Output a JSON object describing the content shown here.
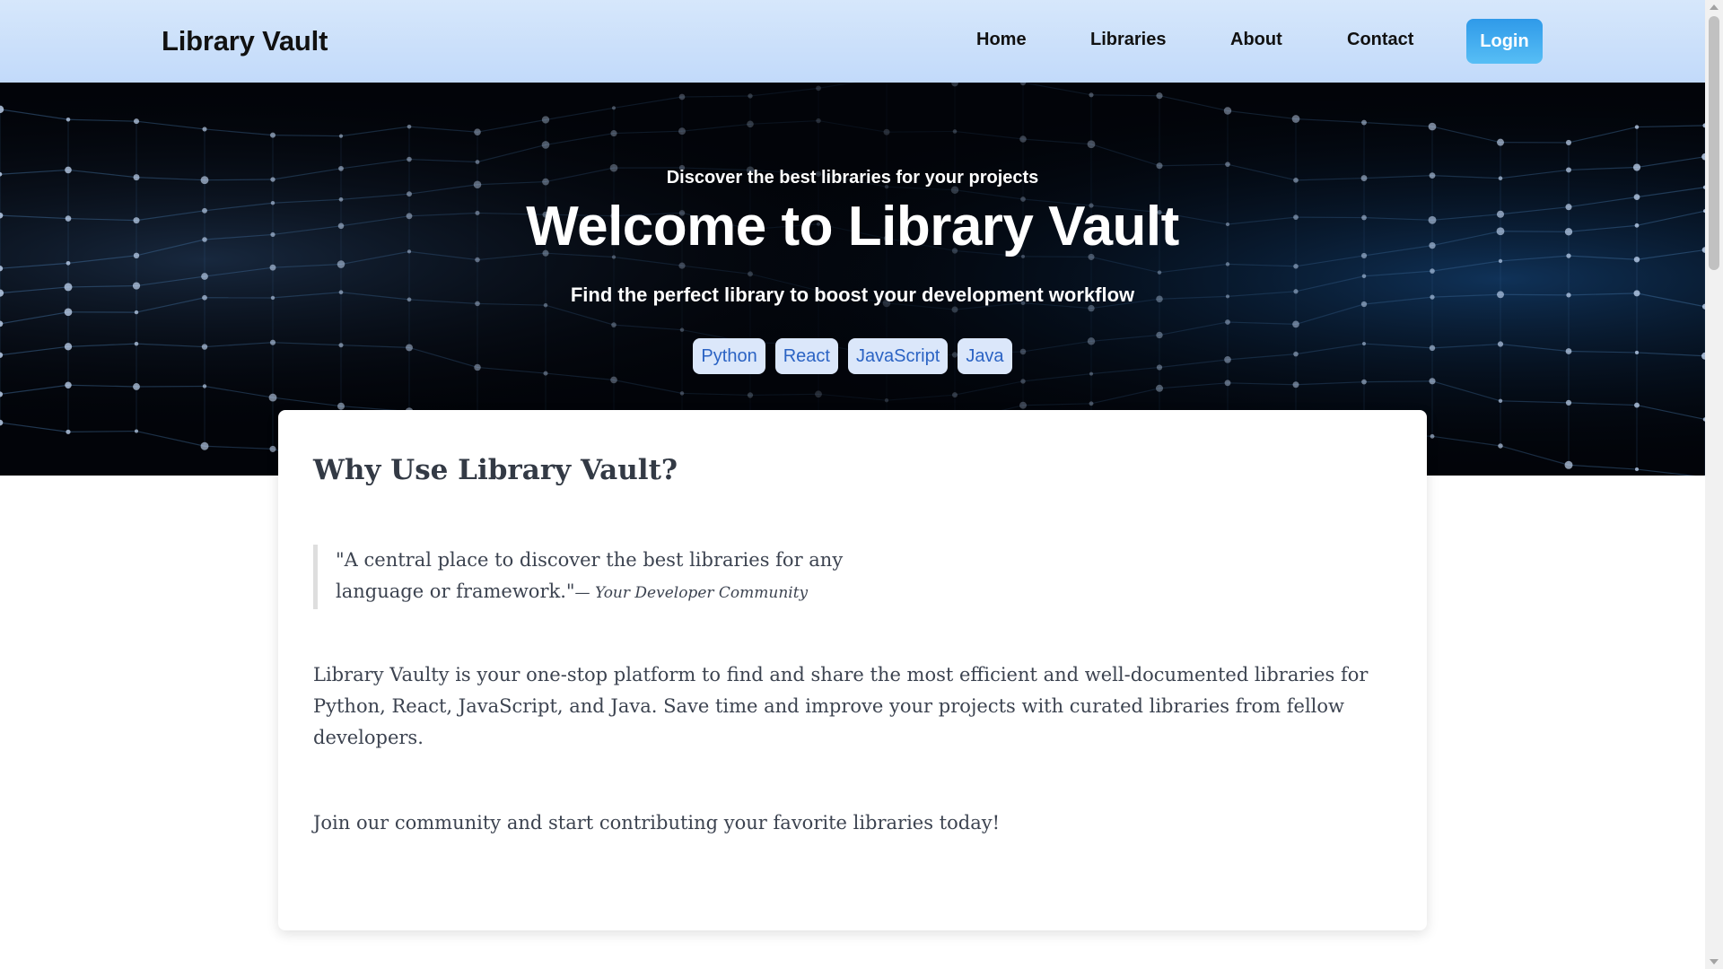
{
  "nav": {
    "brand": "Library Vault",
    "links": [
      {
        "label": "Home"
      },
      {
        "label": "Libraries"
      },
      {
        "label": "About"
      },
      {
        "label": "Contact"
      }
    ],
    "login_label": "Login"
  },
  "hero": {
    "kicker": "Discover the best libraries for your projects",
    "title": "Welcome to Library Vault",
    "subtitle": "Find the perfect library to boost your development workflow",
    "tags": [
      "Python",
      "React",
      "JavaScript",
      "Java"
    ]
  },
  "card": {
    "title": "Why Use Library Vault?",
    "quote_text": "\"A central place to discover the best libraries for any language or framework.\"",
    "quote_cite": "— Your Developer Community",
    "paragraph_1": "Library Vaulty is your one-stop platform to find and share the most efficient and well-documented libraries for Python, React, JavaScript, and Java. Save time and improve your projects with curated libraries from fellow developers.",
    "paragraph_2": "Join our community and start contributing your favorite libraries today!"
  },
  "colors": {
    "nav_background": "#c8dffb",
    "login_button": "#3aa6ee",
    "hero_background": "#020409",
    "tag_background": "#dbe7fa",
    "tag_text": "#2b63c4",
    "body_text": "#3c4350"
  }
}
